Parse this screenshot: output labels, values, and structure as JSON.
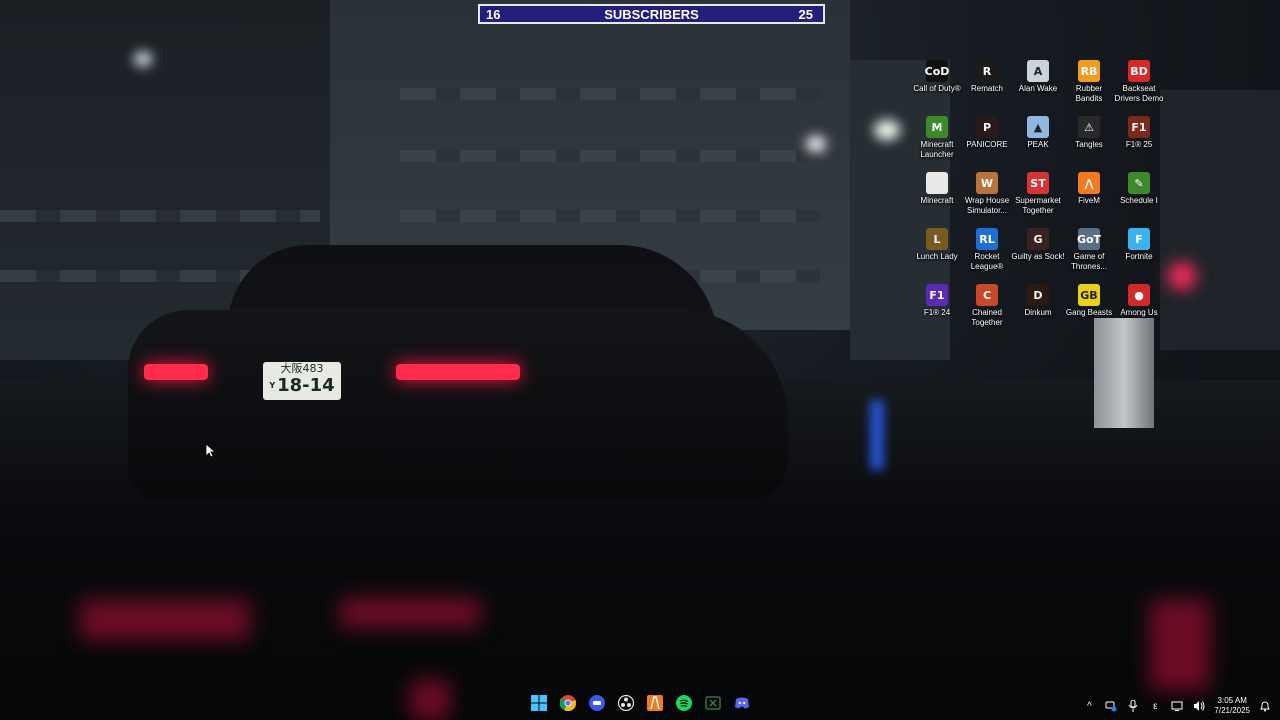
{
  "subscriber_counter": {
    "left_value": "16",
    "title": "SUBSCRIBERS",
    "right_value": "25"
  },
  "plate": {
    "top": "大阪483",
    "prefix": "Y",
    "main": "18-14"
  },
  "desktop_icons": [
    {
      "label": "Call of Duty®",
      "icon": "call-of-duty-icon",
      "color": "#111111",
      "glyph": "CoD"
    },
    {
      "label": "Rematch",
      "icon": "rematch-icon",
      "color": "#1b1b1b",
      "glyph": "R"
    },
    {
      "label": "Alan Wake",
      "icon": "alan-wake-icon",
      "color": "#c9d3d8",
      "glyph": "A"
    },
    {
      "label": "Rubber Bandits",
      "icon": "rubber-bandits-icon",
      "color": "#f29c1f",
      "glyph": "RB"
    },
    {
      "label": "Backseat Drivers Demo",
      "icon": "backseat-drivers-icon",
      "color": "#d8282a",
      "glyph": "BD"
    },
    {
      "label": "Minecraft Launcher",
      "icon": "minecraft-launcher-icon",
      "color": "#3c8a2b",
      "glyph": "M"
    },
    {
      "label": "PANICORE",
      "icon": "panicore-icon",
      "color": "#2a1a1a",
      "glyph": "P"
    },
    {
      "label": "PEAK",
      "icon": "peak-icon",
      "color": "#8fb7e0",
      "glyph": "▲"
    },
    {
      "label": "Tangles",
      "icon": "tangles-icon",
      "color": "#2a2a2a",
      "glyph": "⚠"
    },
    {
      "label": "F1® 25",
      "icon": "f1-25-icon",
      "color": "#7a2a1a",
      "glyph": "F1"
    },
    {
      "label": "Minecraft",
      "icon": "minecraft-file-icon",
      "color": "#e8e8e8",
      "glyph": ""
    },
    {
      "label": "Wrap House Simulator...",
      "icon": "wrap-house-simulator-icon",
      "color": "#b8743a",
      "glyph": "W"
    },
    {
      "label": "Supermarket Together",
      "icon": "supermarket-together-icon",
      "color": "#d83434",
      "glyph": "ST"
    },
    {
      "label": "FiveM",
      "icon": "fivem-icon",
      "color": "#f47a20",
      "glyph": "⋀"
    },
    {
      "label": "Schedule I",
      "icon": "schedule-i-icon",
      "color": "#3c8a2b",
      "glyph": "✎"
    },
    {
      "label": "Lunch Lady",
      "icon": "lunch-lady-icon",
      "color": "#7b5a22",
      "glyph": "L"
    },
    {
      "label": "Rocket League®",
      "icon": "rocket-league-icon",
      "color": "#1d6fd6",
      "glyph": "RL"
    },
    {
      "label": "Guilty as Sock!",
      "icon": "guilty-as-sock-icon",
      "color": "#3a2222",
      "glyph": "G"
    },
    {
      "label": "Game of Thrones...",
      "icon": "game-of-thrones-icon",
      "color": "#5a6f85",
      "glyph": "GoT"
    },
    {
      "label": "Fortnite",
      "icon": "fortnite-icon",
      "color": "#3ab3ef",
      "glyph": "F"
    },
    {
      "label": "F1® 24",
      "icon": "f1-24-icon",
      "color": "#5a2ab3",
      "glyph": "F1"
    },
    {
      "label": "Chained Together",
      "icon": "chained-together-icon",
      "color": "#c44a2a",
      "glyph": "C"
    },
    {
      "label": "Dinkum",
      "icon": "dinkum-icon",
      "color": "#2a1a10",
      "glyph": "D"
    },
    {
      "label": "Gang Beasts",
      "icon": "gang-beasts-icon",
      "color": "#e8d21a",
      "glyph": "GB"
    },
    {
      "label": "Among Us",
      "icon": "among-us-icon",
      "color": "#d12a2a",
      "glyph": "●"
    }
  ],
  "taskbar": [
    {
      "name": "start-button",
      "icon": "windows-logo-icon",
      "color": "#4cc2ff"
    },
    {
      "name": "chrome-button",
      "icon": "chrome-icon",
      "color": "#f2b51c"
    },
    {
      "name": "app-button",
      "icon": "blue-app-icon",
      "color": "#3b58e8"
    },
    {
      "name": "obs-button",
      "icon": "obs-icon",
      "color": "#e5e5e5"
    },
    {
      "name": "fivem-taskbar-button",
      "icon": "fivem-icon",
      "color": "#f47a20"
    },
    {
      "name": "spotify-button",
      "icon": "spotify-icon",
      "color": "#1ed760"
    },
    {
      "name": "xbox-button",
      "icon": "xbox-app-icon",
      "color": "#2e8b57"
    },
    {
      "name": "discord-button",
      "icon": "discord-icon",
      "color": "#5865f2"
    }
  ],
  "tray": {
    "chevron": "^",
    "language": "ε",
    "time": "3:05 AM",
    "date": "7/21/2025"
  }
}
